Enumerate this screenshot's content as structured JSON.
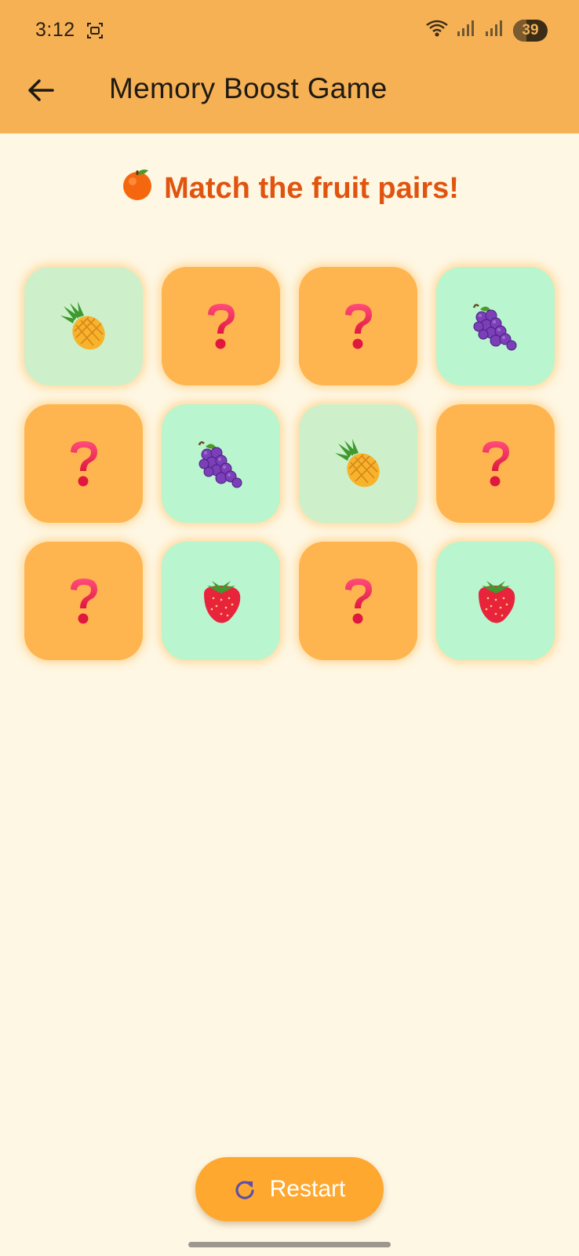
{
  "status_bar": {
    "time": "3:12",
    "battery": "39"
  },
  "appbar": {
    "title": "Memory Boost Game"
  },
  "heading": {
    "emoji": "tangerine",
    "text": "Match the fruit pairs!"
  },
  "grid": {
    "cards": [
      {
        "state": "matched-light",
        "content": "pineapple"
      },
      {
        "state": "hidden",
        "content": "question"
      },
      {
        "state": "hidden",
        "content": "question"
      },
      {
        "state": "matched",
        "content": "grapes"
      },
      {
        "state": "hidden",
        "content": "question"
      },
      {
        "state": "matched",
        "content": "grapes"
      },
      {
        "state": "matched-light",
        "content": "pineapple"
      },
      {
        "state": "hidden",
        "content": "question"
      },
      {
        "state": "hidden",
        "content": "question"
      },
      {
        "state": "matched",
        "content": "strawberry"
      },
      {
        "state": "hidden",
        "content": "question"
      },
      {
        "state": "matched",
        "content": "strawberry"
      }
    ]
  },
  "restart": {
    "label": "Restart"
  },
  "colors": {
    "appbar": "#F6B155",
    "background": "#FEF7E3",
    "heading": "#E0540F",
    "card_hidden": "#FFB54F",
    "card_matched": "#B9F5CF",
    "card_matched_light": "#CDF0CB",
    "restart_button": "#FEA830"
  }
}
